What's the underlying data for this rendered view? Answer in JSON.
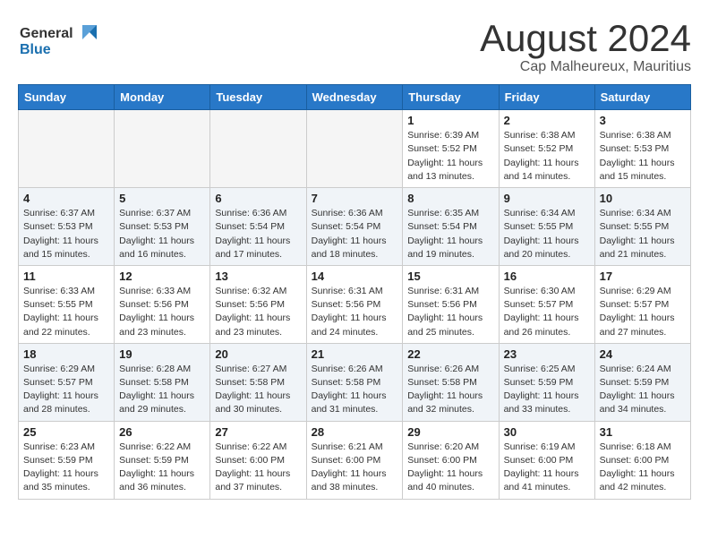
{
  "header": {
    "logo_general": "General",
    "logo_blue": "Blue",
    "month_title": "August 2024",
    "subtitle": "Cap Malheureux, Mauritius"
  },
  "weekdays": [
    "Sunday",
    "Monday",
    "Tuesday",
    "Wednesday",
    "Thursday",
    "Friday",
    "Saturday"
  ],
  "weeks": [
    [
      {
        "day": "",
        "info": "",
        "empty": true
      },
      {
        "day": "",
        "info": "",
        "empty": true
      },
      {
        "day": "",
        "info": "",
        "empty": true
      },
      {
        "day": "",
        "info": "",
        "empty": true
      },
      {
        "day": "1",
        "info": "Sunrise: 6:39 AM\nSunset: 5:52 PM\nDaylight: 11 hours\nand 13 minutes."
      },
      {
        "day": "2",
        "info": "Sunrise: 6:38 AM\nSunset: 5:52 PM\nDaylight: 11 hours\nand 14 minutes."
      },
      {
        "day": "3",
        "info": "Sunrise: 6:38 AM\nSunset: 5:53 PM\nDaylight: 11 hours\nand 15 minutes."
      }
    ],
    [
      {
        "day": "4",
        "info": "Sunrise: 6:37 AM\nSunset: 5:53 PM\nDaylight: 11 hours\nand 15 minutes."
      },
      {
        "day": "5",
        "info": "Sunrise: 6:37 AM\nSunset: 5:53 PM\nDaylight: 11 hours\nand 16 minutes."
      },
      {
        "day": "6",
        "info": "Sunrise: 6:36 AM\nSunset: 5:54 PM\nDaylight: 11 hours\nand 17 minutes."
      },
      {
        "day": "7",
        "info": "Sunrise: 6:36 AM\nSunset: 5:54 PM\nDaylight: 11 hours\nand 18 minutes."
      },
      {
        "day": "8",
        "info": "Sunrise: 6:35 AM\nSunset: 5:54 PM\nDaylight: 11 hours\nand 19 minutes."
      },
      {
        "day": "9",
        "info": "Sunrise: 6:34 AM\nSunset: 5:55 PM\nDaylight: 11 hours\nand 20 minutes."
      },
      {
        "day": "10",
        "info": "Sunrise: 6:34 AM\nSunset: 5:55 PM\nDaylight: 11 hours\nand 21 minutes."
      }
    ],
    [
      {
        "day": "11",
        "info": "Sunrise: 6:33 AM\nSunset: 5:55 PM\nDaylight: 11 hours\nand 22 minutes."
      },
      {
        "day": "12",
        "info": "Sunrise: 6:33 AM\nSunset: 5:56 PM\nDaylight: 11 hours\nand 23 minutes."
      },
      {
        "day": "13",
        "info": "Sunrise: 6:32 AM\nSunset: 5:56 PM\nDaylight: 11 hours\nand 23 minutes."
      },
      {
        "day": "14",
        "info": "Sunrise: 6:31 AM\nSunset: 5:56 PM\nDaylight: 11 hours\nand 24 minutes."
      },
      {
        "day": "15",
        "info": "Sunrise: 6:31 AM\nSunset: 5:56 PM\nDaylight: 11 hours\nand 25 minutes."
      },
      {
        "day": "16",
        "info": "Sunrise: 6:30 AM\nSunset: 5:57 PM\nDaylight: 11 hours\nand 26 minutes."
      },
      {
        "day": "17",
        "info": "Sunrise: 6:29 AM\nSunset: 5:57 PM\nDaylight: 11 hours\nand 27 minutes."
      }
    ],
    [
      {
        "day": "18",
        "info": "Sunrise: 6:29 AM\nSunset: 5:57 PM\nDaylight: 11 hours\nand 28 minutes."
      },
      {
        "day": "19",
        "info": "Sunrise: 6:28 AM\nSunset: 5:58 PM\nDaylight: 11 hours\nand 29 minutes."
      },
      {
        "day": "20",
        "info": "Sunrise: 6:27 AM\nSunset: 5:58 PM\nDaylight: 11 hours\nand 30 minutes."
      },
      {
        "day": "21",
        "info": "Sunrise: 6:26 AM\nSunset: 5:58 PM\nDaylight: 11 hours\nand 31 minutes."
      },
      {
        "day": "22",
        "info": "Sunrise: 6:26 AM\nSunset: 5:58 PM\nDaylight: 11 hours\nand 32 minutes."
      },
      {
        "day": "23",
        "info": "Sunrise: 6:25 AM\nSunset: 5:59 PM\nDaylight: 11 hours\nand 33 minutes."
      },
      {
        "day": "24",
        "info": "Sunrise: 6:24 AM\nSunset: 5:59 PM\nDaylight: 11 hours\nand 34 minutes."
      }
    ],
    [
      {
        "day": "25",
        "info": "Sunrise: 6:23 AM\nSunset: 5:59 PM\nDaylight: 11 hours\nand 35 minutes."
      },
      {
        "day": "26",
        "info": "Sunrise: 6:22 AM\nSunset: 5:59 PM\nDaylight: 11 hours\nand 36 minutes."
      },
      {
        "day": "27",
        "info": "Sunrise: 6:22 AM\nSunset: 6:00 PM\nDaylight: 11 hours\nand 37 minutes."
      },
      {
        "day": "28",
        "info": "Sunrise: 6:21 AM\nSunset: 6:00 PM\nDaylight: 11 hours\nand 38 minutes."
      },
      {
        "day": "29",
        "info": "Sunrise: 6:20 AM\nSunset: 6:00 PM\nDaylight: 11 hours\nand 40 minutes."
      },
      {
        "day": "30",
        "info": "Sunrise: 6:19 AM\nSunset: 6:00 PM\nDaylight: 11 hours\nand 41 minutes."
      },
      {
        "day": "31",
        "info": "Sunrise: 6:18 AM\nSunset: 6:00 PM\nDaylight: 11 hours\nand 42 minutes."
      }
    ]
  ]
}
